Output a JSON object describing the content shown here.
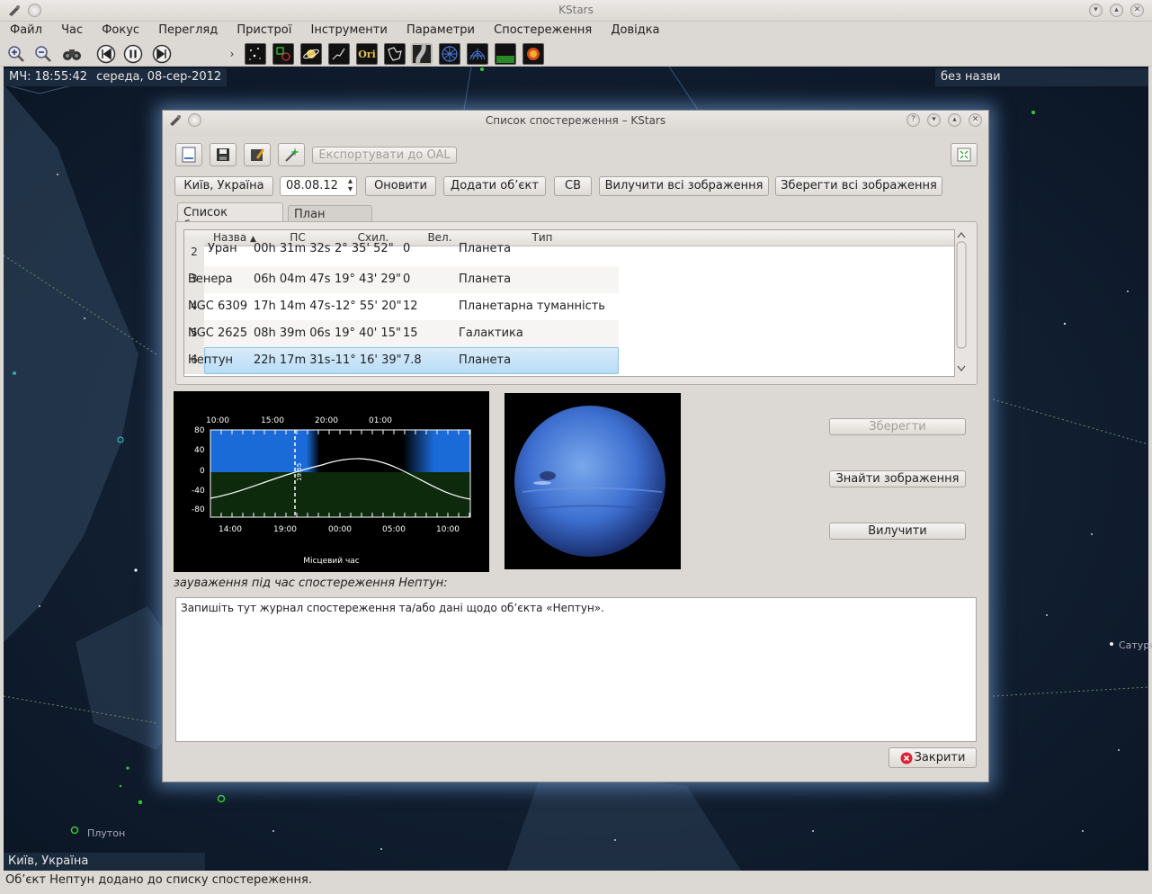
{
  "window": {
    "title": "KStars"
  },
  "menu": [
    "Файл",
    "Час",
    "Фокус",
    "Перегляд",
    "Пристрої",
    "Інструменти",
    "Параметри",
    "Спостереження",
    "Довідка"
  ],
  "sky": {
    "ut_time": "МЧ: 18:55:42",
    "date": "середа, 08-сер-2012",
    "focus_name": "без назви",
    "location": "Київ, Україна",
    "labels": {
      "saturn": "Сатурн",
      "pluto": "Плутон"
    }
  },
  "dialog": {
    "title": "Список спостереження – KStars",
    "export_label": "Експортувати до OAL",
    "location_button": "Київ, Україна",
    "date_value": "08.08.12",
    "update_button": "Оновити",
    "add_object_button": "Додати об’єкт",
    "sv_button": "СВ",
    "delete_images_button": "Вилучити всі зображення",
    "save_images_button": "Зберегти всі зображення",
    "tabs": [
      "Список бажаних",
      "План сеансу"
    ],
    "columns": [
      "Назва",
      "ПС",
      "Схил.",
      "Вел.",
      "Тип"
    ],
    "rows": [
      {
        "num": "2",
        "name": "Уран",
        "ra": "00h 31m 32s",
        "dec": "2° 35' 52\"",
        "mag": "0",
        "type": "Планета"
      },
      {
        "num": "3",
        "name": "Венера",
        "ra": "06h 04m 47s",
        "dec": "19° 43' 29\"",
        "mag": "0",
        "type": "Планета"
      },
      {
        "num": "4",
        "name": "NGC 6309",
        "ra": "17h 14m 47s",
        "dec": "-12° 55' 20\"",
        "mag": "12",
        "type": "Планетарна туманність"
      },
      {
        "num": "5",
        "name": "NGC 2625",
        "ra": "08h 39m 06s",
        "dec": "19° 40' 15\"",
        "mag": "15",
        "type": "Галактика"
      },
      {
        "num": "6",
        "name": "Нептун",
        "ra": "22h 17m 31s",
        "dec": "-11° 16' 39\"",
        "mag": "7.8",
        "type": "Планета"
      }
    ],
    "altchart": {
      "top_ticks": [
        "10:00",
        "15:00",
        "20:00",
        "01:00"
      ],
      "bottom_ticks": [
        "14:00",
        "19:00",
        "00:00",
        "05:00",
        "10:00"
      ],
      "y_ticks": [
        "80",
        "40",
        "0",
        "-40",
        "-80"
      ],
      "xlabel": "Місцевий час",
      "marker": "19:55"
    },
    "save_button": "Зберегти",
    "find_image_button": "Знайти зображення",
    "remove_button": "Вилучити",
    "notes_label": "зауваження під час спостереження Нептун:",
    "notes_text": "Запишіть тут журнал спостереження та/або дані щодо об’єкта «Нептун».",
    "close_button": "Закрити"
  },
  "status": "Об’єкт Нептун додано до списку спостереження."
}
